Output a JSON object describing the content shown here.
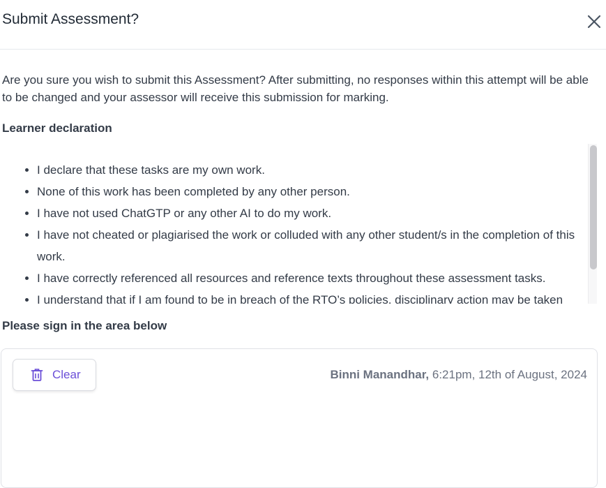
{
  "dialog": {
    "title": "Submit Assessment?",
    "close_icon": "close-icon"
  },
  "intro_text": "Are you sure you wish to submit this Assessment? After submitting, no responses within this attempt will be able to be changed and your assessor will receive this submission for marking.",
  "declaration": {
    "heading": "Learner declaration",
    "items": [
      "I declare that these tasks are my own work.",
      "None of this work has been completed by any other person.",
      "I have not used ChatGTP or any other AI to do my work.",
      "I have not cheated or plagiarised the work or colluded with any other student/s in the completion of this work.",
      "I have correctly referenced all resources and reference texts throughout these assessment tasks.",
      "I understand that if I am found to be in breach of the RTO’s policies, disciplinary action may be taken"
    ]
  },
  "signature": {
    "heading": "Please sign in the area below",
    "clear_label": "Clear",
    "clear_icon": "trash-icon",
    "signer_name": "Binni Manandhar,",
    "signed_at": "6:21pm, 12th of August, 2024"
  },
  "colors": {
    "accent": "#6b4fd8",
    "text": "#333b47",
    "muted": "#6b7280"
  }
}
